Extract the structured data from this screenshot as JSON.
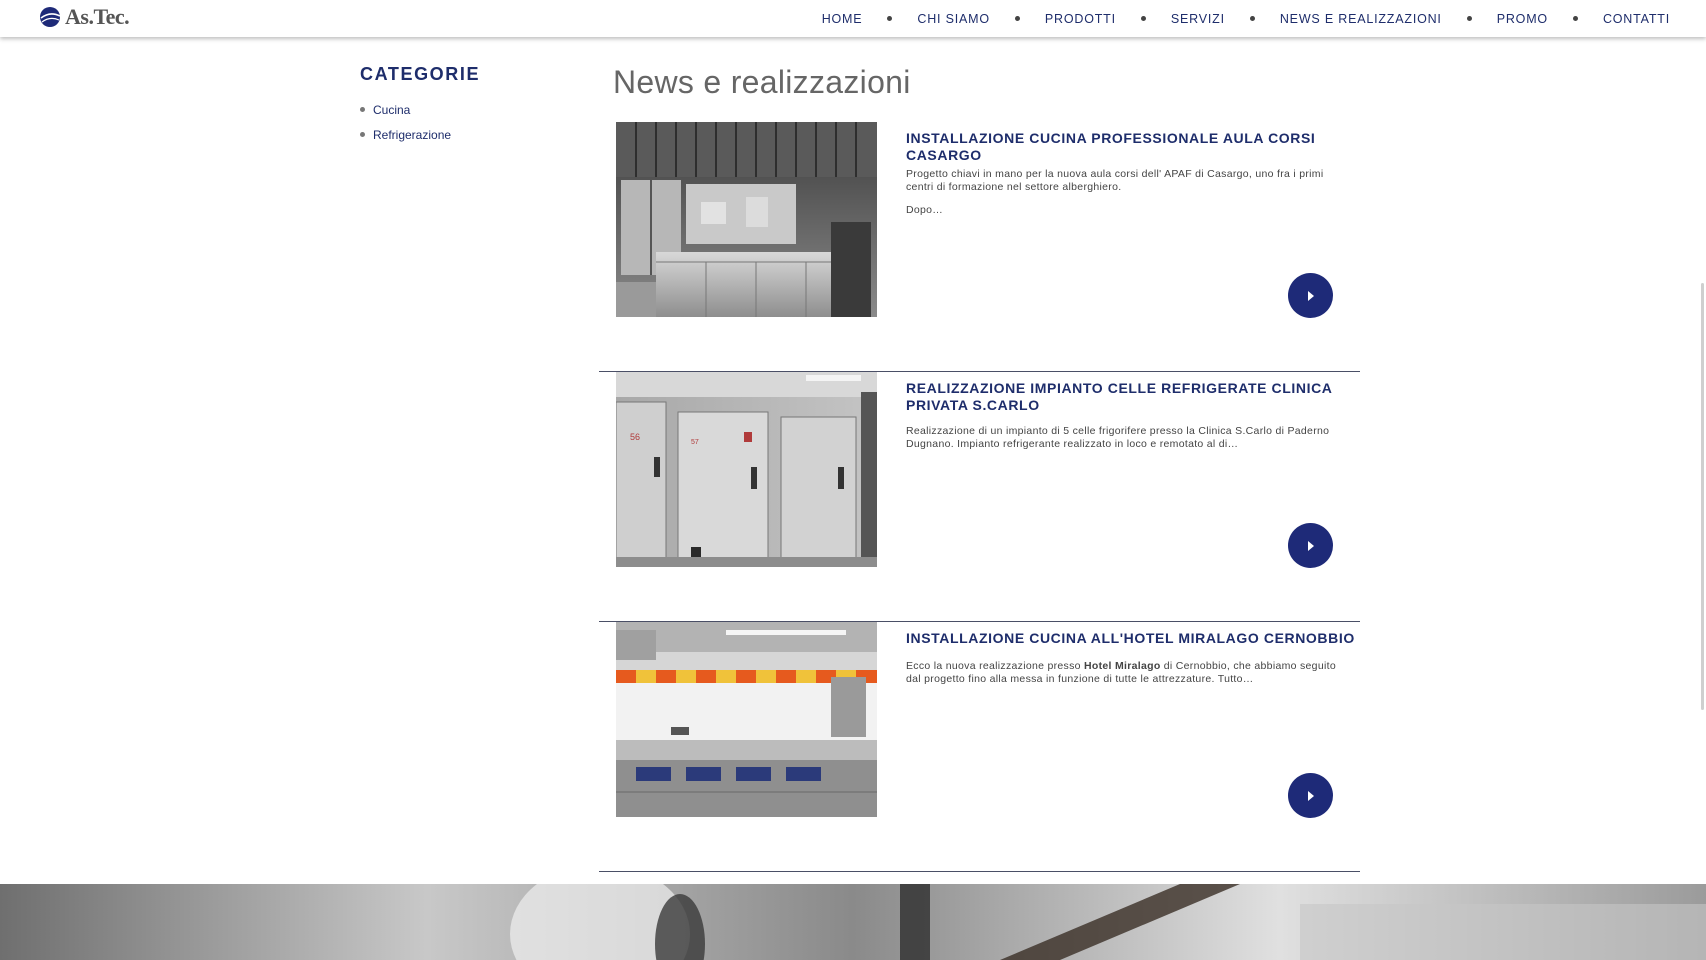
{
  "brand": {
    "name": "As.Tec.",
    "accent_color": "#1e2a78",
    "title_color": "#1e2d6b"
  },
  "nav": {
    "items": [
      {
        "label": "HOME"
      },
      {
        "label": "CHI SIAMO"
      },
      {
        "label": "PRODOTTI"
      },
      {
        "label": "SERVIZI"
      },
      {
        "label": "NEWS E REALIZZAZIONI"
      },
      {
        "label": "PROMO"
      },
      {
        "label": "CONTATTI"
      }
    ]
  },
  "sidebar": {
    "title": "CATEGORIE",
    "categories": [
      {
        "label": "Cucina"
      },
      {
        "label": "Refrigerazione"
      }
    ]
  },
  "main": {
    "title": "News e realizzazioni",
    "articles": [
      {
        "title": "INSTALLAZIONE CUCINA PROFESSIONALE AULA CORSI CASARGO",
        "excerpt": "Progetto chiavi in mano per la nuova aula corsi dell' APAF di Casargo, uno fra i primi centri di formazione nel settore alberghiero.",
        "more": "Dopo…",
        "image_icon": "kitchen-photo",
        "button_icon": "chevron-right-icon"
      },
      {
        "title": "REALIZZAZIONE IMPIANTO CELLE REFRIGERATE CLINICA PRIVATA S.CARLO",
        "excerpt": "Realizzazione di un impianto di 5 celle frigorifere presso la Clinica S.Carlo di Paderno Dugnano. Impianto refrigerante realizzato in loco e remotato al di…",
        "image_icon": "cold-rooms-photo",
        "button_icon": "chevron-right-icon",
        "door_labels": [
          "56",
          "57"
        ]
      },
      {
        "title": "INSTALLAZIONE CUCINA ALL'HOTEL MIRALAGO CERNOBBIO",
        "excerpt_before": "Ecco la nuova realizzazione presso ",
        "excerpt_bold": "Hotel Miralago",
        "excerpt_after": " di Cernobbio, che abbiamo seguito dal progetto fino alla messa in funzione di tutte le attrezzature. Tutto…",
        "image_icon": "hotel-kitchen-photo",
        "button_icon": "chevron-right-icon"
      }
    ]
  }
}
